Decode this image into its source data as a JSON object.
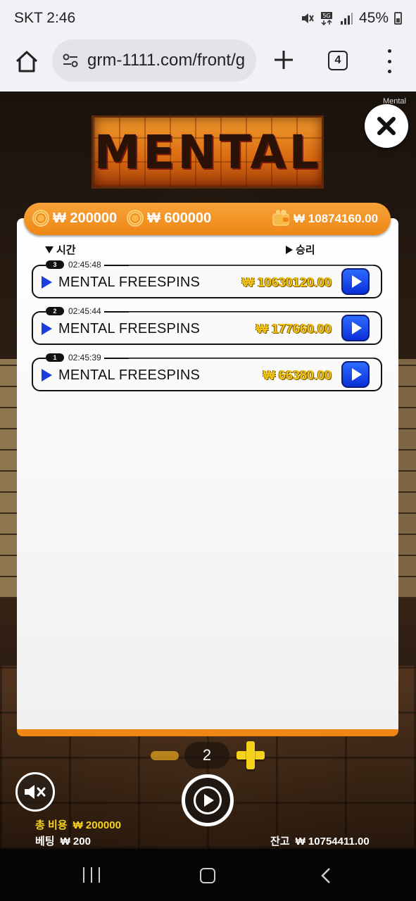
{
  "status_bar": {
    "carrier_time": "SKT 2:46",
    "battery": "45%"
  },
  "browser": {
    "url": "grm-1111.com/front/g",
    "tab_count": "4"
  },
  "game": {
    "corner_tag": "Mental",
    "logo_text": "MENTAL",
    "header": {
      "bet_1": "₩ 200000",
      "bet_2": "₩ 600000",
      "balance": "₩ 10874160.00"
    },
    "columns": {
      "time": "시간",
      "win": "승리"
    },
    "history": [
      {
        "index": "3",
        "time": "02:45:48",
        "title": "MENTAL FREESPINS",
        "amount": "₩ 10630120.00"
      },
      {
        "index": "2",
        "time": "02:45:44",
        "title": "MENTAL FREESPINS",
        "amount": "₩ 177660.00"
      },
      {
        "index": "1",
        "time": "02:45:39",
        "title": "MENTAL FREESPINS",
        "amount": "₩ 66380.00"
      }
    ],
    "counter": "2",
    "footer": {
      "total_label": "총 비용",
      "total_value": "₩ 200000",
      "bet_label": "베팅",
      "bet_value": "₩ 200",
      "balance_label": "잔고",
      "balance_value": "₩ 10754411.00"
    }
  }
}
